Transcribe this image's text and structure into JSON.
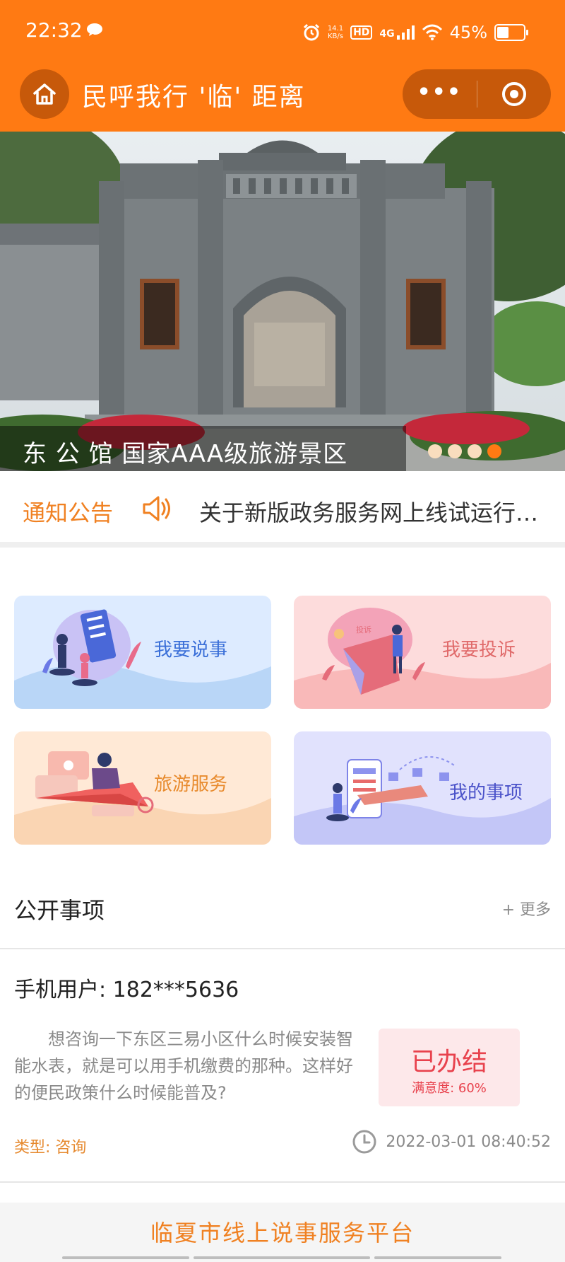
{
  "status_bar": {
    "time": "22:32",
    "net_speed_top": "14.1",
    "net_speed_bottom": "KB/s",
    "hd": "HD",
    "network": "4G",
    "battery": "45%",
    "battery_level": 0.45
  },
  "title_bar": {
    "title": "民呼我行 '临' 距离",
    "home_icon": "home-icon",
    "more_icon": "more-dots-icon",
    "close_icon": "target-circle-icon"
  },
  "banner": {
    "caption": "东 公 馆 国家AAA级旅游景区",
    "slide_count": 4,
    "active_slide": 4
  },
  "notice": {
    "label": "通知公告",
    "text": "关于新版政务服务网上线试运行的公告"
  },
  "services": {
    "speak": "我要说事",
    "complain": "我要投诉",
    "complain_tag": "投诉",
    "travel": "旅游服务",
    "mine": "我的事项"
  },
  "public_items": {
    "title": "公开事项",
    "more": "+ 更多",
    "items": [
      {
        "user": "手机用户: 182***5636",
        "content": "想咨询一下东区三易小区什么时候安装智能水表，就是可以用手机缴费的那种。这样好的便民政策什么时候能普及?",
        "status": "已办结",
        "satisfaction": "满意度: 60%",
        "type": "类型: 咨询",
        "time": "2022-03-01 08:40:52"
      }
    ]
  },
  "footer": {
    "text": "临夏市线上说事服务平台"
  },
  "colors": {
    "brand": "#FF7A13",
    "brand_dark": "#C7590A",
    "accent_orange": "#F08122",
    "status_red": "#E8424D"
  }
}
